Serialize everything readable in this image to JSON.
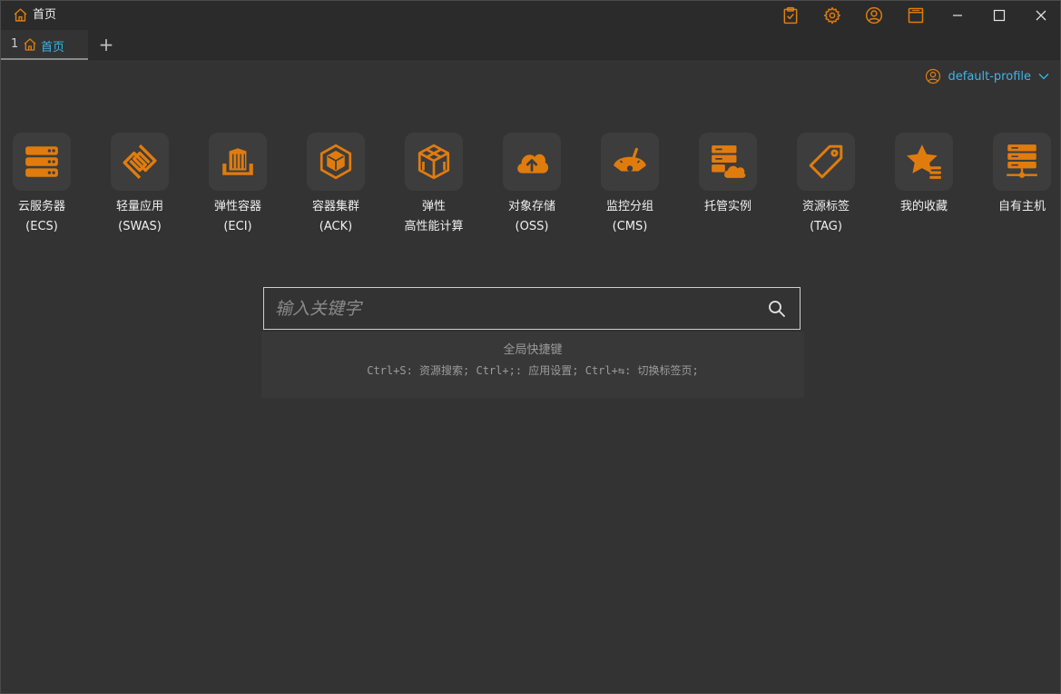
{
  "colors": {
    "accent": "#e07c0e",
    "link": "#3cb6e8",
    "background": "#333333",
    "titlebar": "#2b2b2b"
  },
  "window": {
    "title": "首页"
  },
  "titlebar_icons": [
    "clipboard-check-icon",
    "gear-icon",
    "user-circle-icon",
    "window-panel-icon"
  ],
  "window_controls": [
    "minimize-icon",
    "maximize-icon",
    "close-icon"
  ],
  "tabs": [
    {
      "index": "1",
      "label": "首页",
      "icon": "home-icon"
    }
  ],
  "tab_add": "+",
  "profile": {
    "name": "default-profile",
    "icon": "user-circle-icon"
  },
  "services": [
    {
      "name": "云服务器",
      "sub": "(ECS)",
      "icon": "server-rack-icon"
    },
    {
      "name": "轻量应用",
      "sub": "(SWAS)",
      "icon": "swas-logo-icon"
    },
    {
      "name": "弹性容器",
      "sub": "(ECI)",
      "icon": "container-box-icon"
    },
    {
      "name": "容器集群",
      "sub": "(ACK)",
      "icon": "hexagon-cluster-icon"
    },
    {
      "name": "弹性",
      "sub": "高性能计算",
      "icon": "cube-stack-icon"
    },
    {
      "name": "对象存储",
      "sub": "(OSS)",
      "icon": "cloud-upload-icon"
    },
    {
      "name": "监控分组",
      "sub": "(CMS)",
      "icon": "gauge-icon"
    },
    {
      "name": "托管实例",
      "sub": "",
      "icon": "server-cloud-icon"
    },
    {
      "name": "资源标签",
      "sub": "(TAG)",
      "icon": "tag-icon"
    },
    {
      "name": "我的收藏",
      "sub": "",
      "icon": "star-list-icon"
    },
    {
      "name": "自有主机",
      "sub": "",
      "icon": "server-network-icon"
    }
  ],
  "search": {
    "placeholder": "输入关键字",
    "value": ""
  },
  "shortcuts": {
    "title": "全局快捷键",
    "text": "Ctrl+S: 资源搜索; Ctrl+;: 应用设置;  Ctrl+⇆: 切换标签页;"
  }
}
